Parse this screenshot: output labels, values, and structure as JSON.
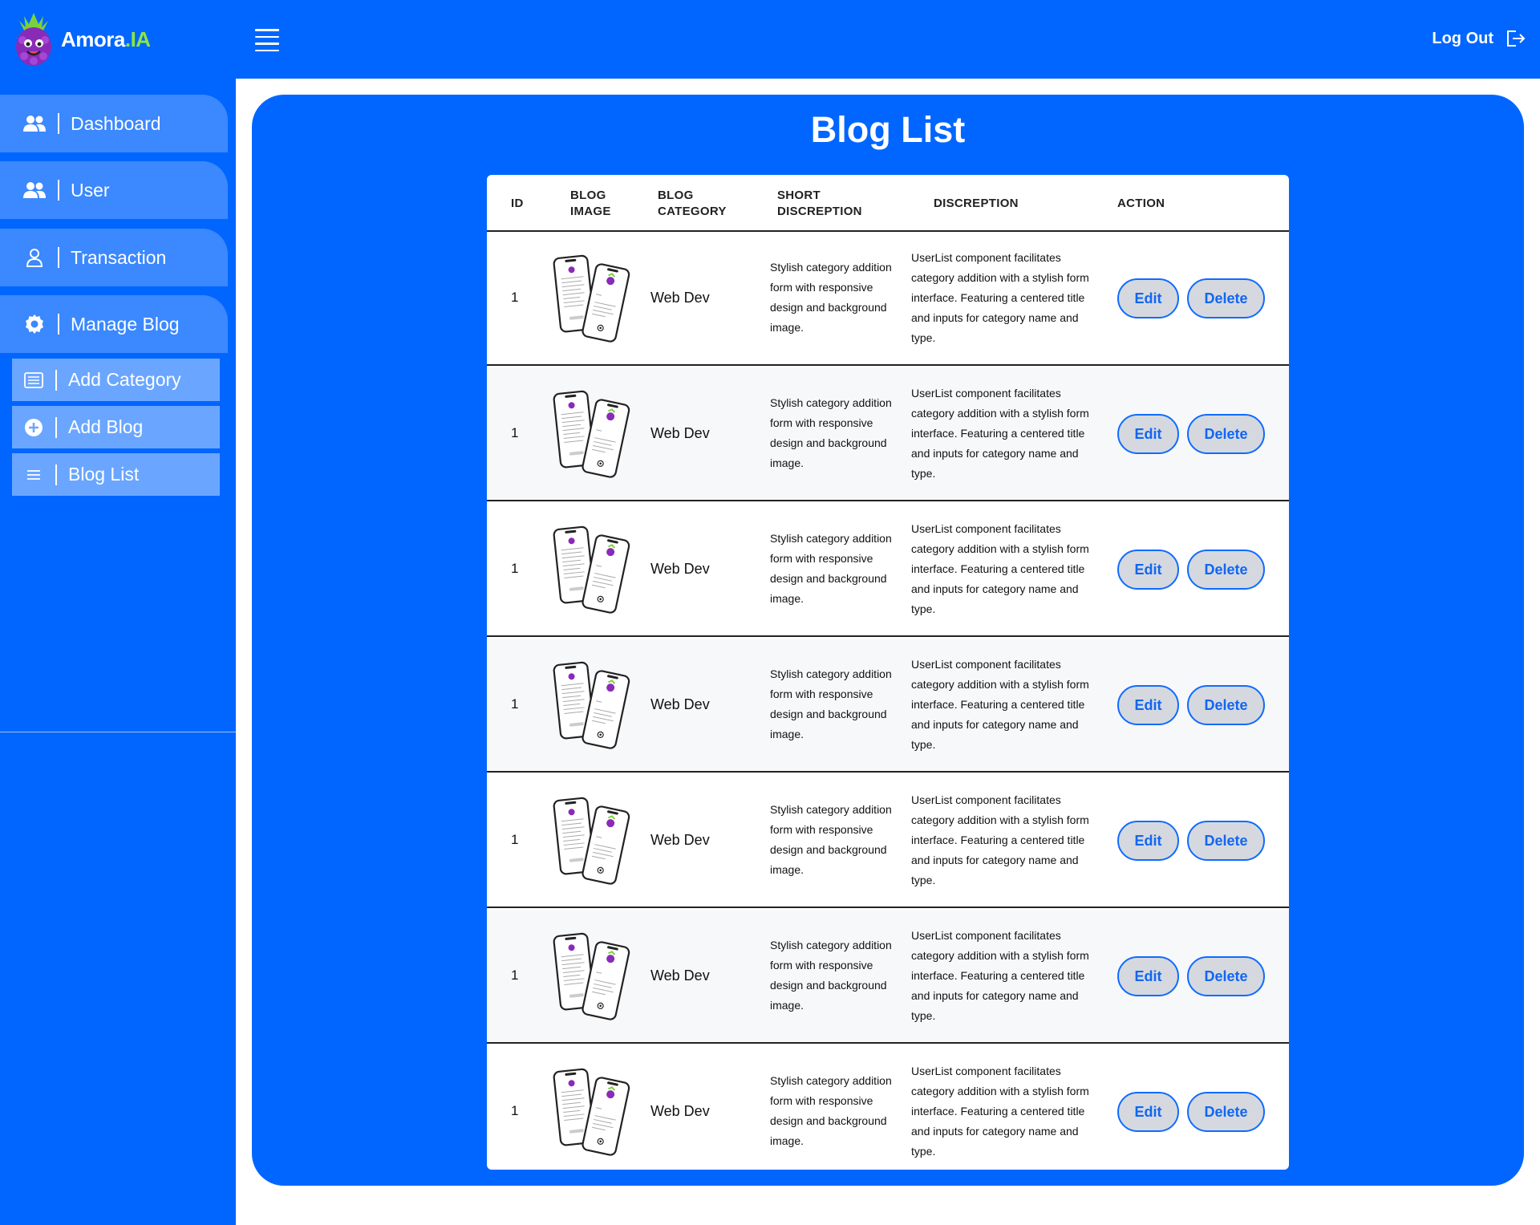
{
  "brand": {
    "name": "Amora",
    "suffix": ".IA",
    "accent": "#8ee53f",
    "primary": "#0066ff"
  },
  "header": {
    "menu_icon": "hamburger-icon",
    "logout_label": "Log Out",
    "logout_icon": "logout-icon"
  },
  "sidebar": {
    "items": [
      {
        "label": "Dashboard",
        "icon": "users-icon"
      },
      {
        "label": "User",
        "icon": "users-icon"
      },
      {
        "label": "Transaction",
        "icon": "person-icon"
      },
      {
        "label": "Manage Blog",
        "icon": "gear-icon"
      }
    ],
    "sub_items": [
      {
        "label": "Add Category",
        "icon": "list-icon"
      },
      {
        "label": "Add Blog",
        "icon": "plus-circle-icon"
      },
      {
        "label": "Blog List",
        "icon": "menu-lines-icon"
      }
    ]
  },
  "main": {
    "title": "Blog List",
    "columns": {
      "id": "ID",
      "image_1": "BLOG",
      "image_2": "IMAGE",
      "category_1": "BLOG",
      "category_2": "CATEGORY",
      "short_1": "SHORT",
      "short_2": "DISCREPTION",
      "desc": "DISCREPTION",
      "action": "ACTION"
    },
    "rows": [
      {
        "id": "1",
        "category": "Web Dev",
        "short": "Stylish category addition form with responsive design and background image.",
        "desc": "UserList component facilitates category addition with a stylish form interface. Featuring a centered title and inputs for category name and type.",
        "edit": "Edit",
        "delete": "Delete"
      },
      {
        "id": "1",
        "category": "Web Dev",
        "short": "Stylish category addition form with responsive design and background image.",
        "desc": "UserList component facilitates category addition with a stylish form interface. Featuring a centered title and inputs for category name and type.",
        "edit": "Edit",
        "delete": "Delete"
      },
      {
        "id": "1",
        "category": "Web Dev",
        "short": "Stylish category addition form with responsive design and background image.",
        "desc": "UserList component facilitates category addition with a stylish form interface. Featuring a centered title and inputs for category name and type.",
        "edit": "Edit",
        "delete": "Delete"
      },
      {
        "id": "1",
        "category": "Web Dev",
        "short": "Stylish category addition form with responsive design and background image.",
        "desc": "UserList component facilitates category addition with a stylish form interface. Featuring a centered title and inputs for category name and type.",
        "edit": "Edit",
        "delete": "Delete"
      },
      {
        "id": "1",
        "category": "Web Dev",
        "short": "Stylish category addition form with responsive design and background image.",
        "desc": "UserList component facilitates category addition with a stylish form interface. Featuring a centered title and inputs for category name and type.",
        "edit": "Edit",
        "delete": "Delete"
      },
      {
        "id": "1",
        "category": "Web Dev",
        "short": "Stylish category addition form with responsive design and background image.",
        "desc": "UserList component facilitates category addition with a stylish form interface. Featuring a centered title and inputs for category name and type.",
        "edit": "Edit",
        "delete": "Delete"
      },
      {
        "id": "1",
        "category": "Web Dev",
        "short": "Stylish category addition form with responsive design and background image.",
        "desc": "UserList component facilitates category addition with a stylish form interface. Featuring a centered title and inputs for category name and type.",
        "edit": "Edit",
        "delete": "Delete"
      }
    ]
  }
}
